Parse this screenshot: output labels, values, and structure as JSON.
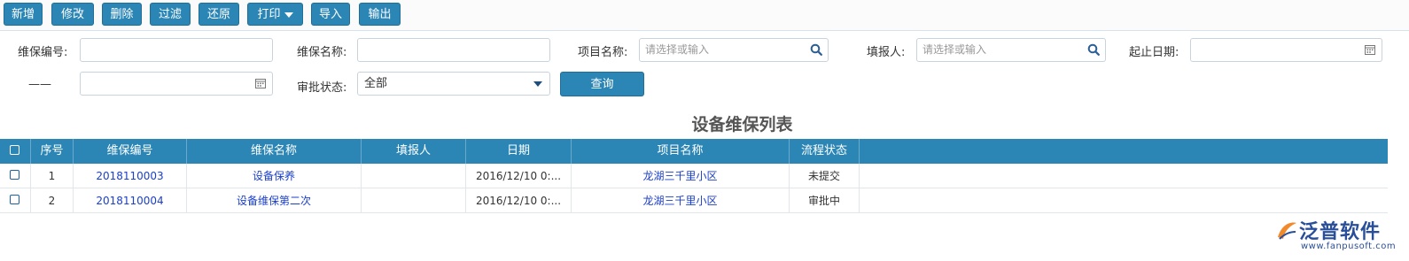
{
  "toolbar": {
    "add": "新增",
    "edit": "修改",
    "delete": "删除",
    "filter": "过滤",
    "restore": "还原",
    "print": "打印",
    "import": "导入",
    "export": "输出"
  },
  "filters": {
    "code_label": "维保编号:",
    "code_value": "",
    "name_label": "维保名称:",
    "name_value": "",
    "project_label": "项目名称:",
    "project_placeholder": "请选择或输入",
    "reporter_label": "填报人:",
    "reporter_placeholder": "请选择或输入",
    "date_label": "起止日期:",
    "date_from": "",
    "range_separator": "——",
    "date_to": "",
    "status_label": "审批状态:",
    "status_value": "全部",
    "query_button": "查询"
  },
  "list_title": "设备维保列表",
  "table": {
    "headers": [
      "序号",
      "维保编号",
      "维保名称",
      "填报人",
      "日期",
      "项目名称",
      "流程状态"
    ],
    "rows": [
      {
        "index": "1",
        "code": "2018110003",
        "name": "设备保养",
        "reporter": "",
        "date": "2016/12/10 0:...",
        "project": "龙湖三千里小区",
        "status": "未提交"
      },
      {
        "index": "2",
        "code": "2018110004",
        "name": "设备维保第二次",
        "reporter": "",
        "date": "2016/12/10 0:...",
        "project": "龙湖三千里小区",
        "status": "审批中"
      }
    ]
  },
  "logo": {
    "name": "泛普软件",
    "url": "www.fanpusoft.com"
  },
  "colors": {
    "accent": "#2b86b5",
    "link": "#1a3fc8",
    "logo": "#2a4f9a"
  },
  "icons": [
    "search-icon",
    "calendar-icon",
    "chevron-down-icon",
    "checkbox-icon",
    "logo-icon"
  ]
}
